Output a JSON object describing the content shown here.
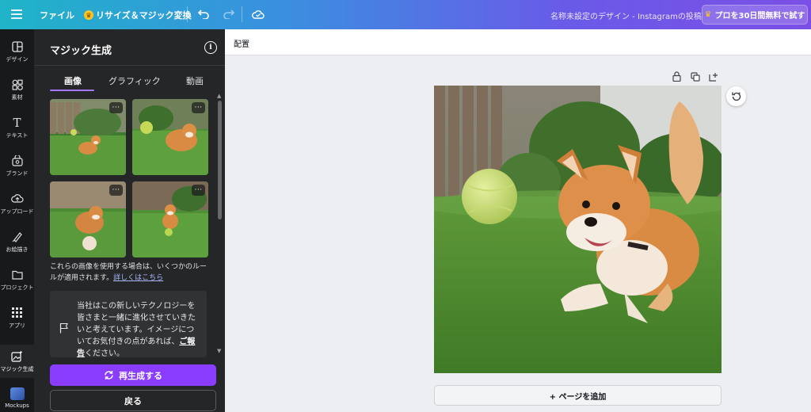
{
  "topbar": {
    "menu_icon": "hamburger-icon",
    "file_label": "ファイル",
    "resize_label": "リサイズ＆マジック変換",
    "document_title": "名称未設定のデザイン - Instagramの投稿",
    "pro_label": "プロを30日間無料で試す",
    "brand_gradient": [
      "#1fb4c8",
      "#7b4fe6"
    ]
  },
  "rail": {
    "items": [
      {
        "label": "デザイン",
        "icon": "layout-icon"
      },
      {
        "label": "素材",
        "icon": "shapes-icon"
      },
      {
        "label": "テキスト",
        "icon": "text-icon"
      },
      {
        "label": "ブランド",
        "icon": "brand-icon"
      },
      {
        "label": "アップロード",
        "icon": "upload-cloud-icon"
      },
      {
        "label": "お絵描き",
        "icon": "draw-icon"
      },
      {
        "label": "プロジェクト",
        "icon": "folder-icon"
      },
      {
        "label": "アプリ",
        "icon": "apps-grid-icon"
      },
      {
        "label": "マジック生成",
        "icon": "magic-image-icon"
      },
      {
        "label": "Mockups",
        "icon": "mockups-app-icon"
      }
    ]
  },
  "panel": {
    "title": "マジック生成",
    "tabs": [
      {
        "label": "画像",
        "active": true
      },
      {
        "label": "グラフィック",
        "active": false
      },
      {
        "label": "動画",
        "active": false
      }
    ],
    "more_glyph": "···",
    "notice_text": "これらの画像を使用する場合は、いくつかのルールが適用されます。",
    "notice_link": "詳しくはこちら",
    "feedback_text_before": "当社はこの新しいテクノロジーを皆さまと一緒に進化させていきたいと考えています。イメージについてお気付きの点があれば、",
    "feedback_link": "ご報告",
    "feedback_text_after": "ください。",
    "regenerate_label": "再生成する",
    "back_label": "戻る",
    "accent_color": "#8b3dff"
  },
  "canvas": {
    "context_label": "配置",
    "add_page_label": "+ ページを追加"
  }
}
